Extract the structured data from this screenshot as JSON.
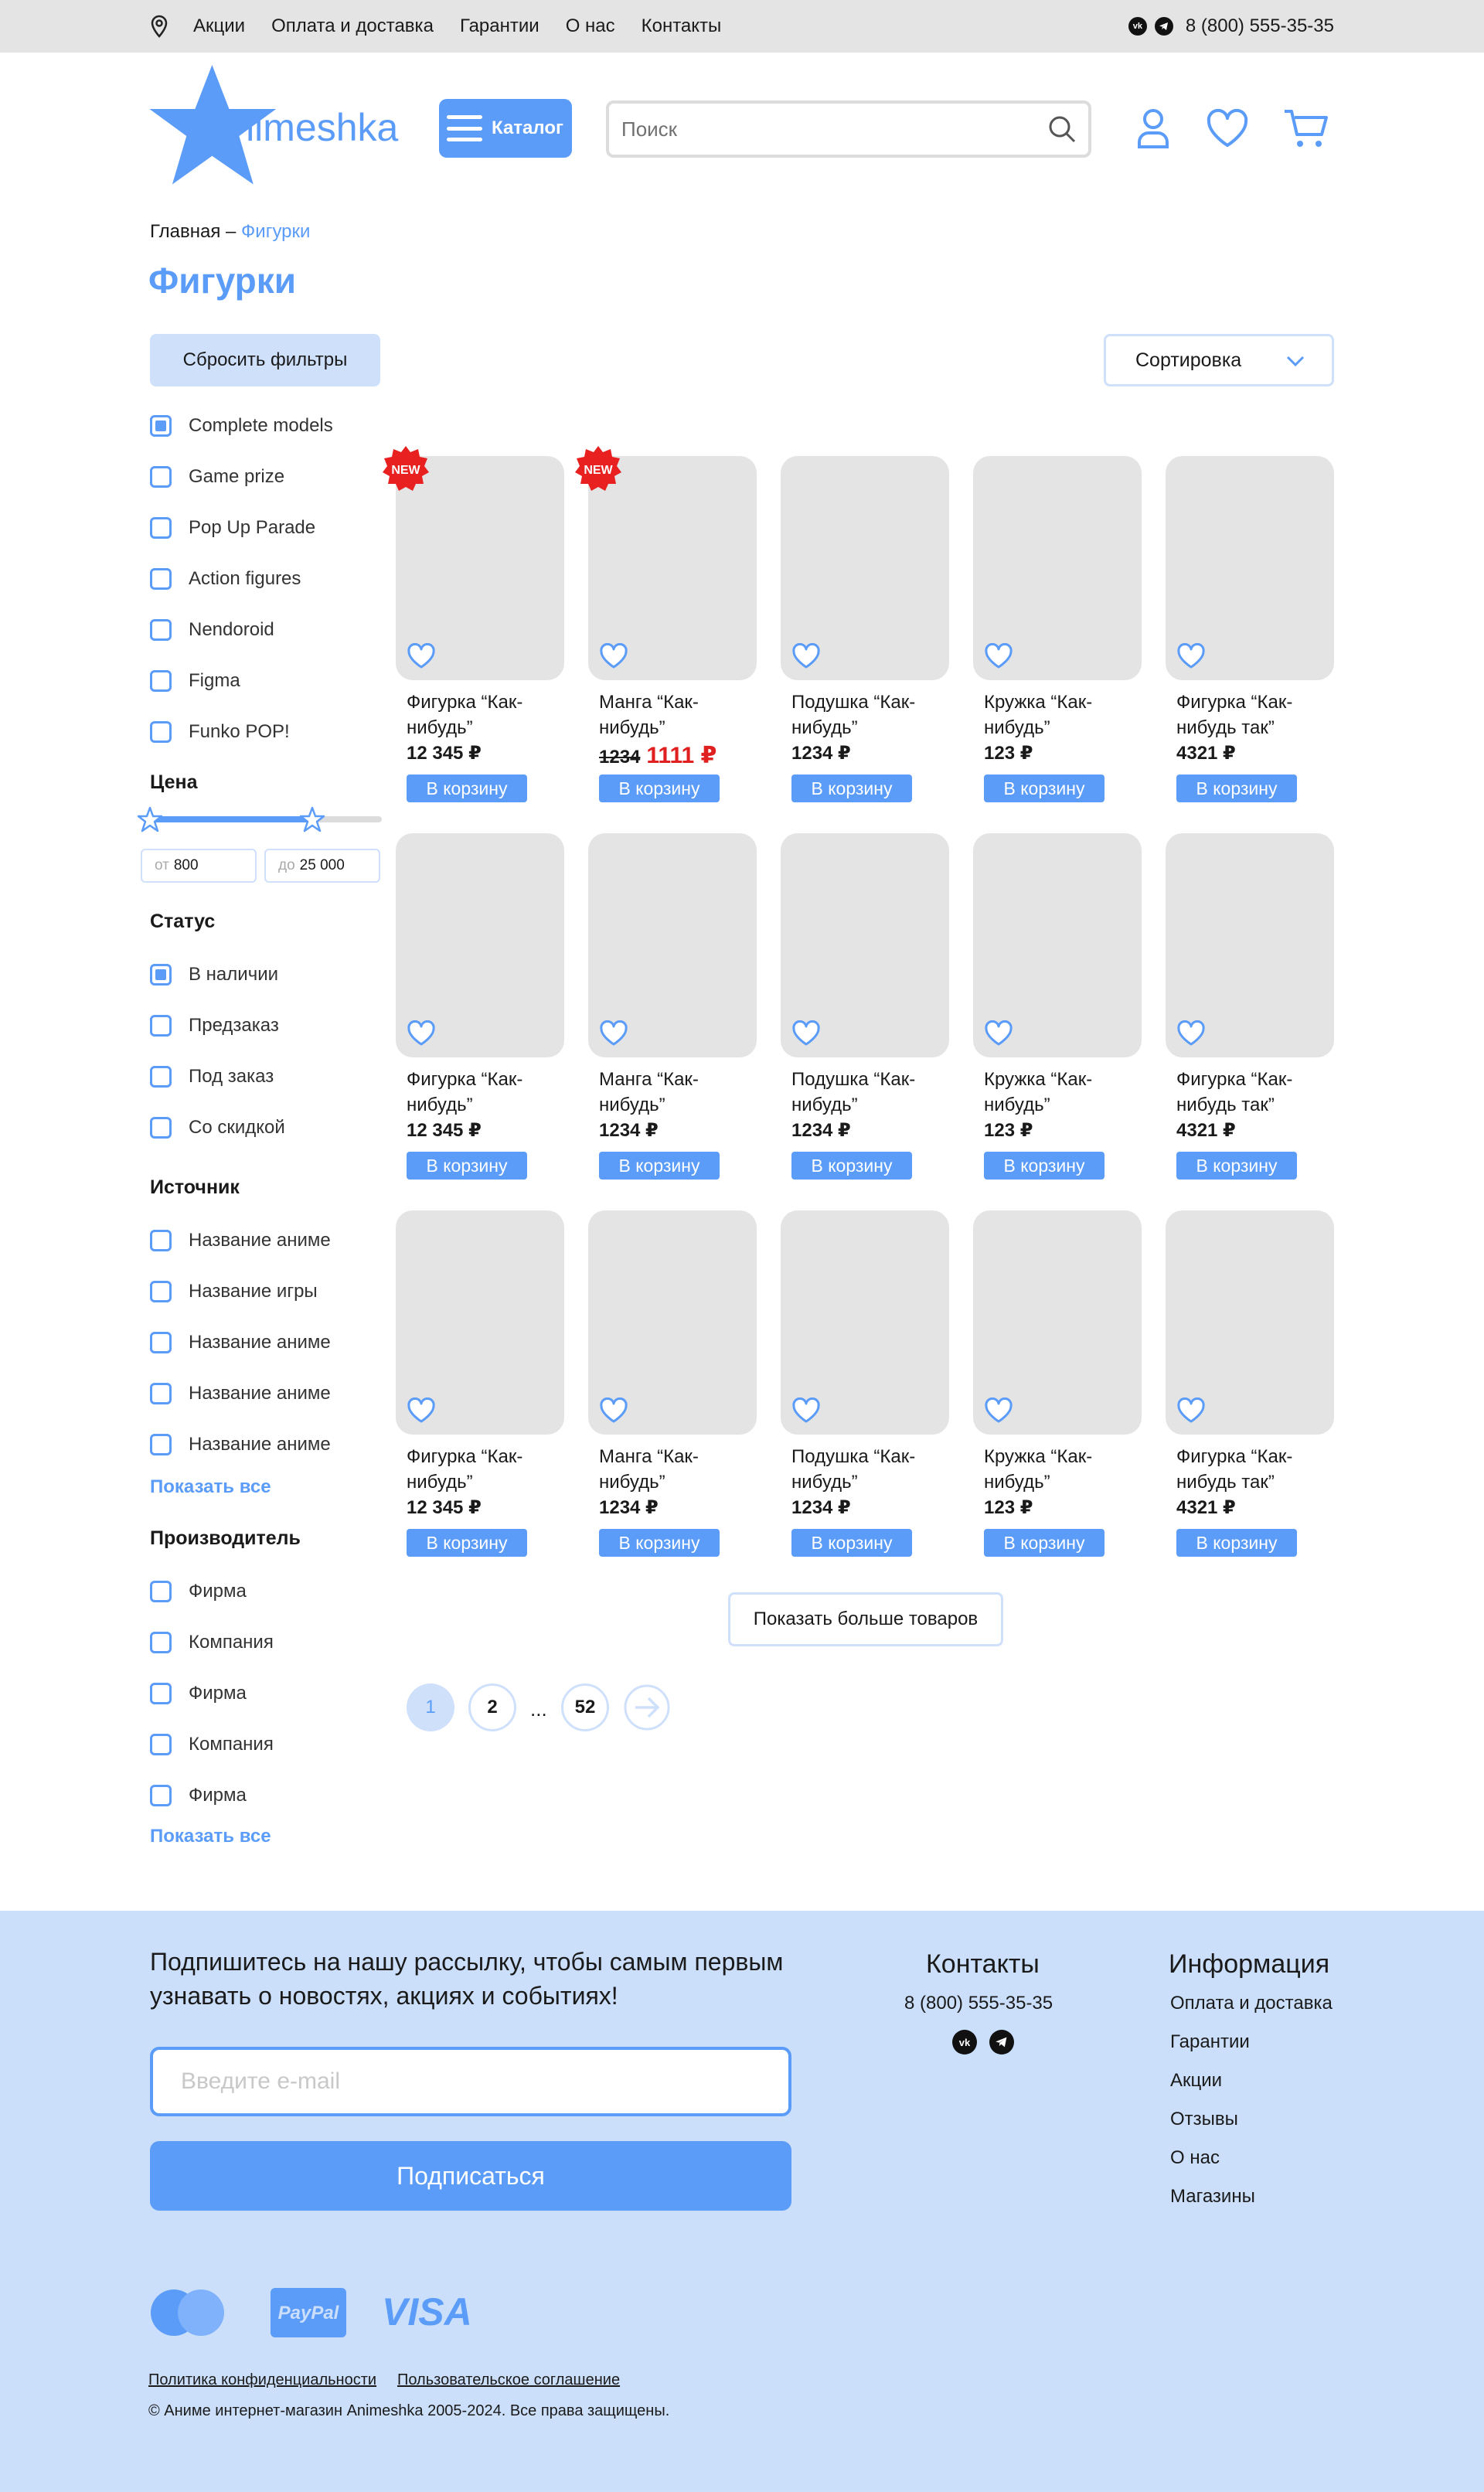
{
  "topbar": {
    "nav": [
      "Акции",
      "Оплата и доставка",
      "Гарантии",
      "О нас",
      "Контакты"
    ],
    "social": [
      "vk",
      "tg"
    ],
    "phone": "8 (800) 555-35-35"
  },
  "header": {
    "logo_text": "Animeshka",
    "catalog_label": "Каталог",
    "search_placeholder": "Поиск",
    "icons": [
      "user-icon",
      "heart-icon",
      "cart-icon"
    ]
  },
  "breadcrumb": {
    "home": "Главная",
    "sep": " – ",
    "current": "Фигурки"
  },
  "page_title": "Фигурки",
  "filters": {
    "reset_label": "Сбросить фильтры",
    "sort_label": "Сортировка",
    "types": [
      {
        "label": "Complete models",
        "checked": true
      },
      {
        "label": "Game prize",
        "checked": false
      },
      {
        "label": "Pop Up Parade",
        "checked": false
      },
      {
        "label": "Action figures",
        "checked": false
      },
      {
        "label": "Nendoroid",
        "checked": false
      },
      {
        "label": "Figma",
        "checked": false
      },
      {
        "label": "Funko POP!",
        "checked": false
      }
    ],
    "price": {
      "title": "Цена",
      "from_ph": "от",
      "from": "800",
      "to_ph": "до",
      "to": "25 000",
      "range_fill": 0.7
    },
    "status": {
      "title": "Статус",
      "items": [
        {
          "label": "В наличии",
          "checked": true
        },
        {
          "label": "Предзаказ",
          "checked": false
        },
        {
          "label": "Под заказ",
          "checked": false
        },
        {
          "label": "Со скидкой",
          "checked": false
        }
      ]
    },
    "source": {
      "title": "Источник",
      "items": [
        {
          "label": "Название аниме",
          "checked": false
        },
        {
          "label": "Название игры",
          "checked": false
        },
        {
          "label": "Название аниме",
          "checked": false
        },
        {
          "label": "Название аниме",
          "checked": false
        },
        {
          "label": "Название аниме",
          "checked": false
        }
      ],
      "show_all": "Показать все"
    },
    "maker": {
      "title": "Производитель",
      "items": [
        {
          "label": "Фирма",
          "checked": false
        },
        {
          "label": "Компания",
          "checked": false
        },
        {
          "label": "Фирма",
          "checked": false
        },
        {
          "label": "Компания",
          "checked": false
        },
        {
          "label": "Фирма",
          "checked": false
        }
      ],
      "show_all": "Показать все"
    }
  },
  "products": [
    {
      "name": "Фигурка “Как-нибудь”",
      "price": "12 345 ₽",
      "badge": "NEW"
    },
    {
      "name": "Манга “Как-нибудь”",
      "old_price": "1234",
      "price": "1111 ₽",
      "badge": "NEW"
    },
    {
      "name": "Подушка “Как-нибудь”",
      "price": "1234 ₽"
    },
    {
      "name": "Кружка “Как-нибудь”",
      "price": "123 ₽"
    },
    {
      "name": "Фигурка “Как-нибудь так”",
      "price": "4321 ₽"
    },
    {
      "name": "Фигурка “Как-нибудь”",
      "price": "12 345 ₽"
    },
    {
      "name": "Манга “Как-нибудь”",
      "price": "1234 ₽"
    },
    {
      "name": "Подушка “Как-нибудь”",
      "price": "1234 ₽"
    },
    {
      "name": "Кружка “Как-нибудь”",
      "price": "123 ₽"
    },
    {
      "name": "Фигурка “Как-нибудь так”",
      "price": "4321 ₽"
    },
    {
      "name": "Фигурка “Как-нибудь”",
      "price": "12 345 ₽"
    },
    {
      "name": "Манга “Как-нибудь”",
      "price": "1234 ₽"
    },
    {
      "name": "Подушка “Как-нибудь”",
      "price": "1234 ₽"
    },
    {
      "name": "Кружка “Как-нибудь”",
      "price": "123 ₽"
    },
    {
      "name": "Фигурка “Как-нибудь так”",
      "price": "4321 ₽"
    }
  ],
  "cart_label": "В корзину",
  "show_more": "Показать больше товаров",
  "pagination": {
    "pages": [
      "1",
      "2",
      "52"
    ],
    "current": "1",
    "ellipsis": "..."
  },
  "footer": {
    "subscribe_text": "Подпишитесь на нашу рассылку, чтобы самым первым узнавать о новостях, акциях и событиях!",
    "email_placeholder": "Введите e-mail",
    "subscribe_label": "Подписаться",
    "contacts_title": "Контакты",
    "phone": "8 (800) 555-35-35",
    "info_title": "Информация",
    "info_links": [
      "Оплата и доставка",
      "Гарантии",
      "Акции",
      "Отзывы",
      "О нас",
      "Магазины"
    ],
    "payments": [
      "mastercard",
      "PayPal",
      "VISA"
    ],
    "privacy": "Политика конфиденциальности",
    "terms": "Пользовательское соглашение",
    "copyright": "© Аниме интернет-магазин Animeshka 2005-2024. Все права защищены."
  },
  "colors": {
    "accent": "#5b9cf8",
    "accent_light": "#cfe0fb",
    "footer_bg": "#cbdffb",
    "sale": "#e02020",
    "badge": "#e82020"
  }
}
